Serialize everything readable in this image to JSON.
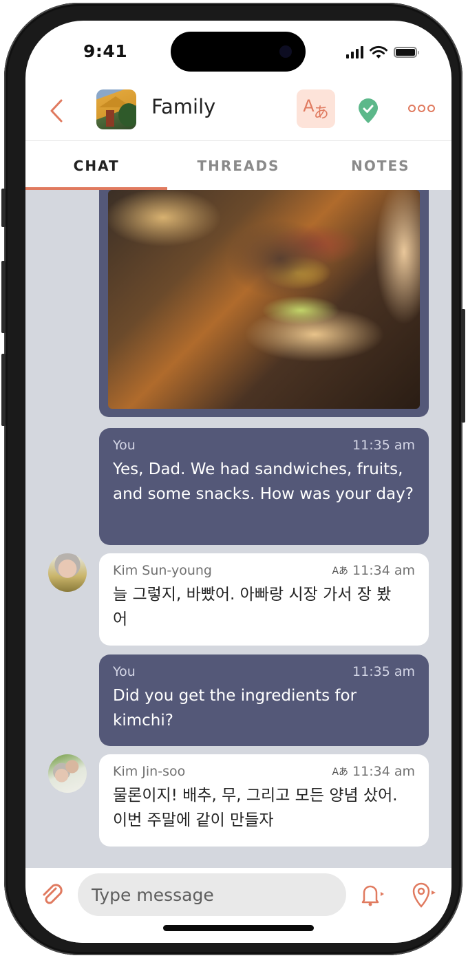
{
  "status_bar": {
    "time": "9:41",
    "signal_icon": "cellular-signal-icon",
    "wifi_icon": "wifi-icon",
    "battery_icon": "battery-icon"
  },
  "header": {
    "back_icon": "chevron-left-icon",
    "group_name": "Family",
    "translate_icon": "translate-icon",
    "translate_glyph_a": "A",
    "translate_glyph_b": "あ",
    "verified_icon": "verified-shield-icon",
    "more_icon": "more-icon"
  },
  "tabs": [
    {
      "label": "CHAT",
      "active": true
    },
    {
      "label": "THREADS",
      "active": false
    },
    {
      "label": "NOTES",
      "active": false
    }
  ],
  "messages": [
    {
      "type": "image",
      "direction": "out",
      "image_desc": "burger with bacon, cheese and fries on wooden board"
    },
    {
      "type": "text",
      "direction": "out",
      "sender": "You",
      "time": "11:35 am",
      "text": "Yes, Dad. We had sandwiches, fruits, and some snacks. How was your day?"
    },
    {
      "type": "text",
      "direction": "in",
      "sender": "Kim Sun-young",
      "time": "11:34 am",
      "translate_mark": "Aあ",
      "text": "늘 그렇지, 바빴어. 아빠랑 시장 가서 장 봤어"
    },
    {
      "type": "text",
      "direction": "out",
      "sender": "You",
      "time": "11:35 am",
      "text": "Did you get the ingredients for kimchi?"
    },
    {
      "type": "text",
      "direction": "in",
      "sender": "Kim Jin-soo",
      "time": "11:34 am",
      "translate_mark": "Aあ",
      "text": "물론이지! 배추, 무, 그리고 모든 양념 샀어. 이번 주말에 같이 만들자"
    }
  ],
  "composer": {
    "attach_icon": "paperclip-icon",
    "placeholder": "Type message",
    "value": "",
    "alert_icon": "bell-send-icon",
    "location_icon": "location-send-icon"
  },
  "colors": {
    "accent": "#e07a5f",
    "accent_soft": "#fde3d9",
    "outgoing_bubble": "#545878",
    "incoming_bubble": "#ffffff",
    "chat_background": "#d4d7de",
    "verified_green": "#5cb88a"
  }
}
